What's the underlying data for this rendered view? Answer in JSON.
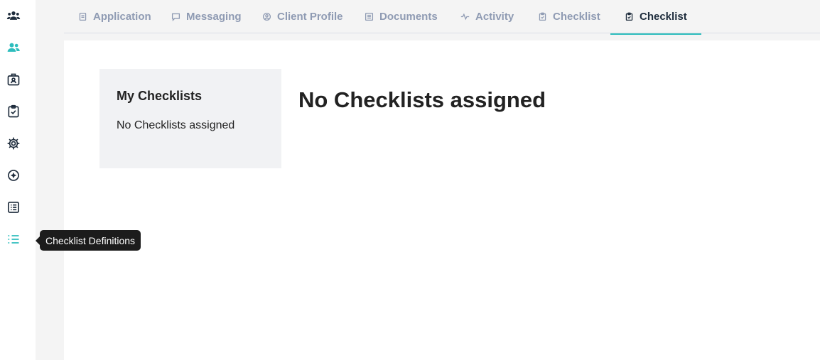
{
  "colors": {
    "accent": "#2ebdbd",
    "nav_icon": "#1f2d3d",
    "tab_inactive": "#8f9bb3"
  },
  "sidebar": {
    "items": [
      {
        "icon": "team-icon",
        "label": ""
      },
      {
        "icon": "users-icon",
        "label": ""
      },
      {
        "icon": "id-badge-icon",
        "label": ""
      },
      {
        "icon": "clipboard-check-icon",
        "label": ""
      },
      {
        "icon": "gear-icon",
        "label": ""
      },
      {
        "icon": "compass-icon",
        "label": ""
      },
      {
        "icon": "list-box-icon",
        "label": ""
      },
      {
        "icon": "list-icon",
        "label": "Checklist Definitions"
      }
    ]
  },
  "tabs": [
    {
      "label": "Application",
      "icon": "document-icon"
    },
    {
      "label": "Messaging",
      "icon": "chat-icon"
    },
    {
      "label": "Client Profile",
      "icon": "user-circle-icon"
    },
    {
      "label": "Documents",
      "icon": "documents-icon"
    },
    {
      "label": "Activity",
      "icon": "activity-icon"
    },
    {
      "label": "Checklist",
      "icon": "clipboard-check-icon"
    },
    {
      "label": "Checklist",
      "icon": "clipboard-check-icon",
      "active": true
    }
  ],
  "panel": {
    "title": "My Checklists",
    "empty": "No Checklists assigned"
  },
  "main": {
    "heading": "No Checklists assigned"
  },
  "tooltip": {
    "text": "Checklist Definitions"
  }
}
